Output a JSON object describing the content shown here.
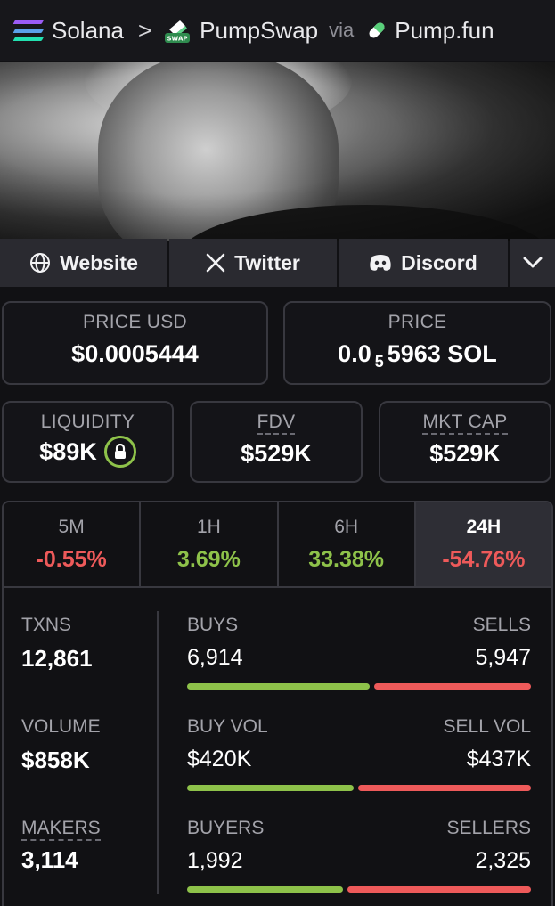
{
  "breadcrumb": {
    "chain": "Solana",
    "separator": ">",
    "dex": "PumpSwap",
    "dex_icon_text": "SWAP",
    "via": "via",
    "launchpad": "Pump.fun"
  },
  "social": {
    "website": "Website",
    "twitter": "Twitter",
    "discord": "Discord"
  },
  "price": {
    "usd_label": "PRICE USD",
    "usd_value": "$0.0005444",
    "native_label": "PRICE",
    "native_prefix": "0.0",
    "native_zeros": "5",
    "native_digits": "5963 SOL"
  },
  "metrics": {
    "liquidity_label": "LIQUIDITY",
    "liquidity_value": "$89K",
    "fdv_label": "FDV",
    "fdv_value": "$529K",
    "mktcap_label": "MKT CAP",
    "mktcap_value": "$529K"
  },
  "periods": [
    {
      "label": "5M",
      "value": "-0.55%",
      "color": "#ee5a5a"
    },
    {
      "label": "1H",
      "value": "3.69%",
      "color": "#8ec24a"
    },
    {
      "label": "6H",
      "value": "33.38%",
      "color": "#8ec24a"
    },
    {
      "label": "24H",
      "value": "-54.76%",
      "color": "#ee5a5a"
    }
  ],
  "stats": {
    "txns_label": "TXNS",
    "txns_value": "12,861",
    "volume_label": "VOLUME",
    "volume_value": "$858K",
    "makers_label": "MAKERS",
    "makers_value": "3,114",
    "buys_label": "BUYS",
    "buys_value": "6,914",
    "sells_label": "SELLS",
    "sells_value": "5,947",
    "buy_vol_label": "BUY VOL",
    "buy_vol_value": "$420K",
    "sell_vol_label": "SELL VOL",
    "sell_vol_value": "$437K",
    "buyers_label": "BUYERS",
    "buyers_value": "1,992",
    "sellers_label": "SELLERS",
    "sellers_value": "2,325",
    "buys_ratio": 0.538,
    "buy_vol_ratio": 0.49,
    "buyers_ratio": 0.461
  },
  "colors": {
    "green": "#8ec24a",
    "red": "#ee5a5a",
    "border": "#38383f"
  }
}
